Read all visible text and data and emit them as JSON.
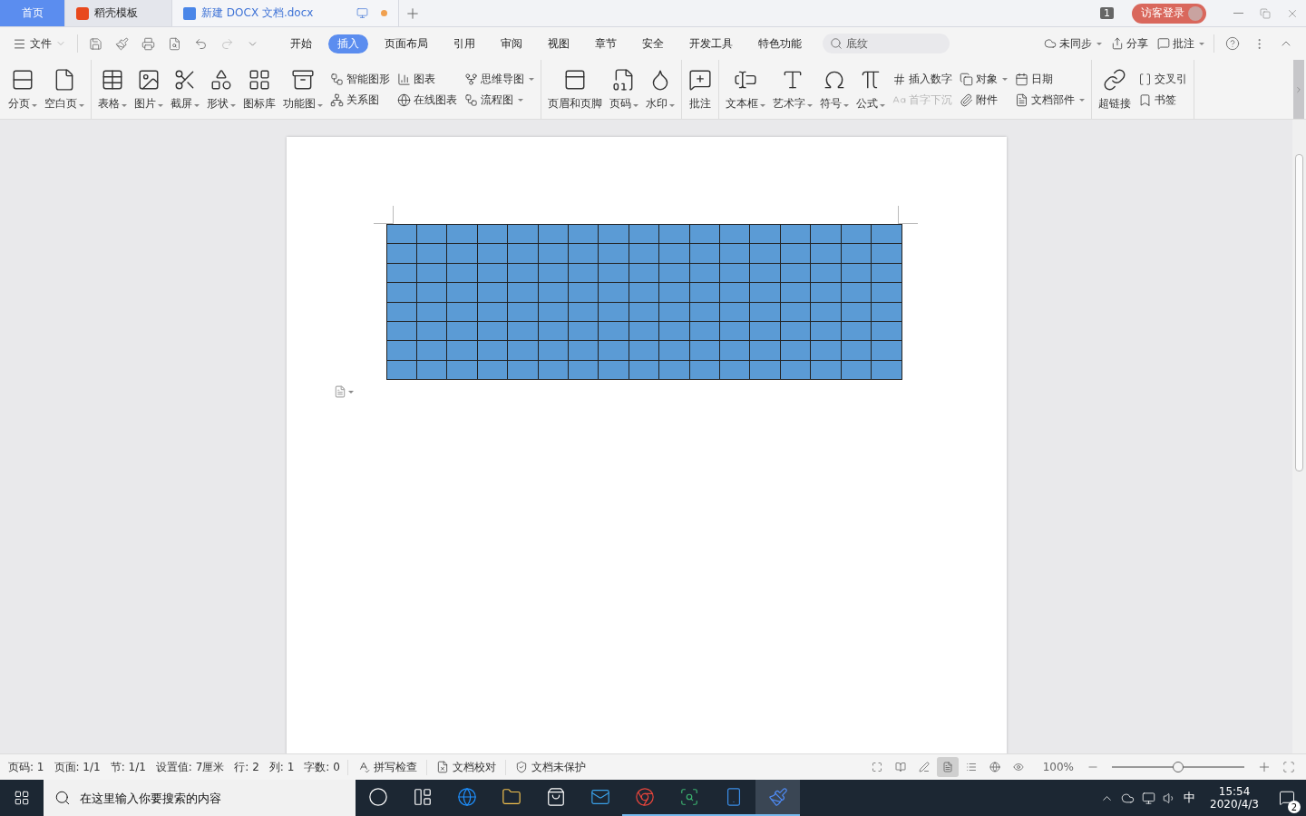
{
  "title_tabs": [
    {
      "kind": "home",
      "label": "首页",
      "selected": false
    },
    {
      "kind": "template",
      "label": "稻壳模板",
      "selected": false
    },
    {
      "kind": "document",
      "label": "新建 DOCX 文档.docx",
      "selected": true,
      "unsaved": true
    }
  ],
  "window_badge": "1",
  "login_button": "访客登录",
  "file_menu": "文件",
  "ribbon_tabs": [
    {
      "label": "开始",
      "selected": false
    },
    {
      "label": "插入",
      "selected": true
    },
    {
      "label": "页面布局",
      "selected": false
    },
    {
      "label": "引用",
      "selected": false
    },
    {
      "label": "审阅",
      "selected": false
    },
    {
      "label": "视图",
      "selected": false
    },
    {
      "label": "章节",
      "selected": false
    },
    {
      "label": "安全",
      "selected": false
    },
    {
      "label": "开发工具",
      "selected": false
    },
    {
      "label": "特色功能",
      "selected": false
    }
  ],
  "search": {
    "placeholder": "底纹"
  },
  "top_actions": [
    {
      "label": "未同步",
      "dropdown": true
    },
    {
      "label": "分享",
      "dropdown": false
    },
    {
      "label": "批注",
      "dropdown": true
    }
  ],
  "ribbon_groups": [
    {
      "items": [
        {
          "kind": "large",
          "label": "分页",
          "dropdown": true
        },
        {
          "kind": "large",
          "label": "空白页",
          "dropdown": true
        }
      ]
    },
    {
      "items": [
        {
          "kind": "large",
          "label": "表格",
          "dropdown": true
        },
        {
          "kind": "large",
          "label": "图片",
          "dropdown": true
        },
        {
          "kind": "large",
          "label": "截屏",
          "dropdown": true
        },
        {
          "kind": "large",
          "label": "形状",
          "dropdown": true
        },
        {
          "kind": "large",
          "label": "图标库",
          "dropdown": false
        },
        {
          "kind": "large",
          "label": "功能图",
          "dropdown": true
        },
        {
          "kind": "stack",
          "items": [
            {
              "label": "智能图形",
              "dropdown": false,
              "disabled": false
            },
            {
              "label": "关系图",
              "dropdown": false,
              "disabled": false
            }
          ]
        },
        {
          "kind": "stack",
          "items": [
            {
              "label": "图表",
              "dropdown": false,
              "disabled": false
            },
            {
              "label": "在线图表",
              "dropdown": false,
              "disabled": false
            }
          ]
        },
        {
          "kind": "stack",
          "items": [
            {
              "label": "思维导图",
              "dropdown": true,
              "disabled": false
            },
            {
              "label": "流程图",
              "dropdown": true,
              "disabled": false
            }
          ]
        }
      ]
    },
    {
      "items": [
        {
          "kind": "large",
          "label": "页眉和页脚",
          "dropdown": false
        },
        {
          "kind": "large",
          "label": "页码",
          "dropdown": true
        },
        {
          "kind": "large",
          "label": "水印",
          "dropdown": true
        }
      ]
    },
    {
      "items": [
        {
          "kind": "large",
          "label": "批注",
          "dropdown": false
        }
      ]
    },
    {
      "items": [
        {
          "kind": "large",
          "label": "文本框",
          "dropdown": true
        },
        {
          "kind": "large",
          "label": "艺术字",
          "dropdown": true
        },
        {
          "kind": "large",
          "label": "符号",
          "dropdown": true
        },
        {
          "kind": "large",
          "label": "公式",
          "dropdown": true
        },
        {
          "kind": "stack",
          "items": [
            {
              "label": "插入数字",
              "dropdown": false,
              "disabled": false
            },
            {
              "label": "首字下沉",
              "dropdown": false,
              "disabled": true
            }
          ]
        },
        {
          "kind": "stack",
          "items": [
            {
              "label": "对象",
              "dropdown": true,
              "disabled": false
            },
            {
              "label": "附件",
              "dropdown": false,
              "disabled": false
            }
          ]
        },
        {
          "kind": "stack",
          "items": [
            {
              "label": "日期",
              "dropdown": false,
              "disabled": false
            },
            {
              "label": "文档部件",
              "dropdown": true,
              "disabled": false
            }
          ]
        }
      ]
    },
    {
      "items": [
        {
          "kind": "large",
          "label": "超链接",
          "dropdown": false
        },
        {
          "kind": "stack",
          "items": [
            {
              "label": "交叉引",
              "dropdown": false,
              "disabled": false
            },
            {
              "label": "书签",
              "dropdown": false,
              "disabled": false
            }
          ]
        }
      ]
    }
  ],
  "status_bar": {
    "fields": [
      "页码: 1",
      "页面: 1/1",
      "节: 1/1",
      "设置值: 7厘米",
      "行: 2",
      "列: 1",
      "字数: 0"
    ],
    "buttons": [
      "拼写检查",
      "文档校对",
      "文档未保护"
    ],
    "view_modes": [
      {
        "selected": false
      },
      {
        "selected": false
      },
      {
        "selected": false
      },
      {
        "selected": true
      },
      {
        "selected": false
      },
      {
        "selected": false
      },
      {
        "selected": false
      }
    ],
    "zoom": "100%",
    "zoom_level": {
      "level": 0.5
    }
  },
  "taskbar": {
    "search": {
      "placeholder": "在这里输入你要搜索的内容"
    },
    "apps": [
      {
        "running": false,
        "selected": false
      },
      {
        "running": false,
        "selected": false
      },
      {
        "running": false,
        "selected": false
      },
      {
        "running": false,
        "selected": false
      },
      {
        "running": false,
        "selected": false
      },
      {
        "running": false,
        "selected": false
      },
      {
        "running": true,
        "selected": false
      },
      {
        "running": true,
        "selected": false
      },
      {
        "running": true,
        "selected": false
      },
      {
        "running": true,
        "selected": true
      }
    ],
    "ime": "中",
    "time": "15:54",
    "date": "2020/4/3",
    "notifications": "2"
  }
}
